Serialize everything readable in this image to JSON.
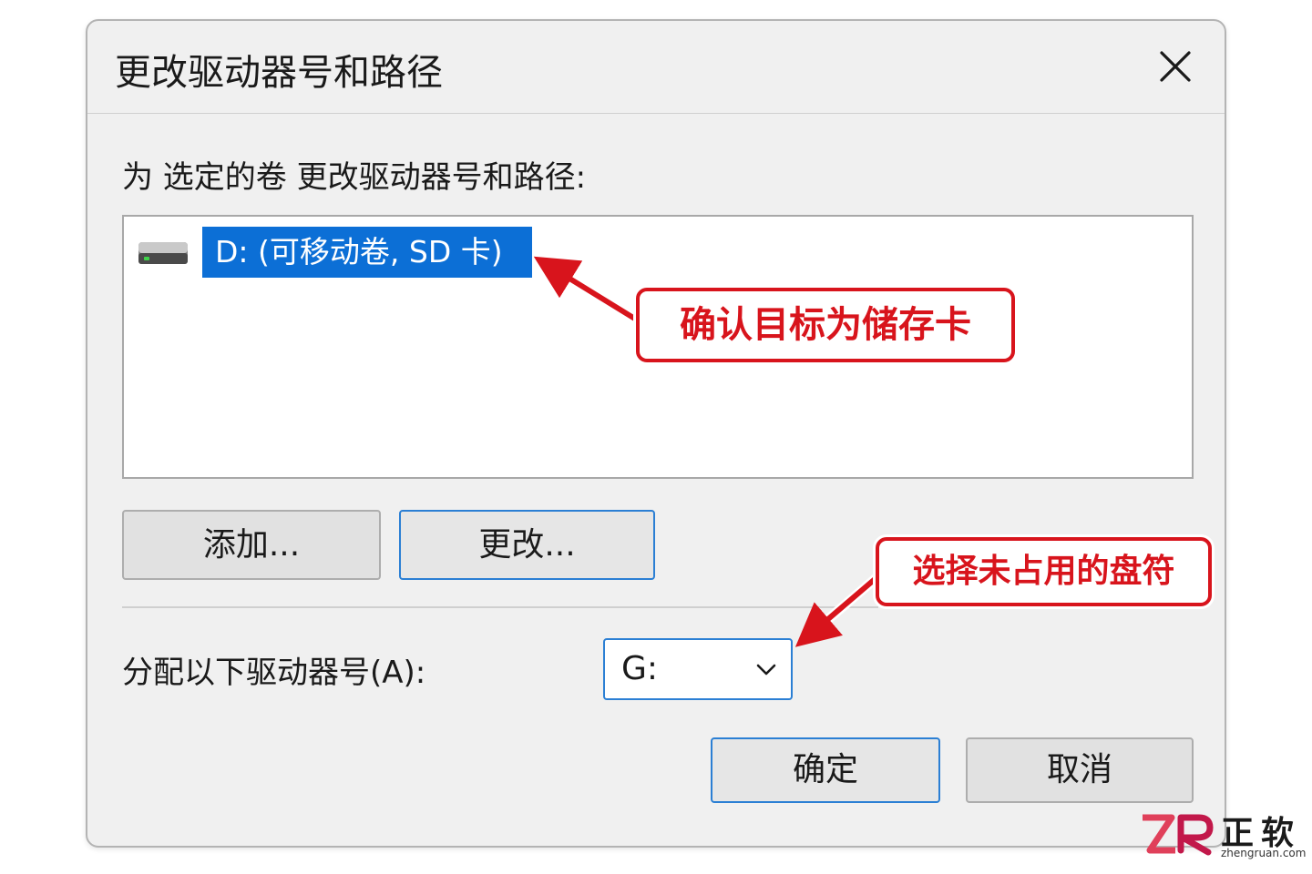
{
  "dialog": {
    "title": "更改驱动器号和路径",
    "instruction": "为 选定的卷 更改驱动器号和路径:",
    "volume_list": {
      "items": [
        {
          "label": "D: (可移动卷, SD 卡)",
          "selected": true,
          "icon": "removable-drive-icon"
        }
      ]
    },
    "buttons": {
      "add": "添加...",
      "change": "更改...",
      "ok": "确定",
      "cancel": "取消"
    },
    "assign": {
      "label": "分配以下驱动器号(A):",
      "selected_value": "G:"
    },
    "close_icon": "close-icon"
  },
  "annotations": {
    "target_note": "确认目标为储存卡",
    "letter_note": "选择未占用的盘符",
    "color": "#d8141c"
  },
  "watermark": {
    "brand_cn": "正软",
    "url": "zhengruan.com",
    "mark": "ZR"
  },
  "colors": {
    "selection": "#0c6fd6",
    "focus_border": "#2b7fd4",
    "dialog_bg": "#f0f0f0"
  }
}
